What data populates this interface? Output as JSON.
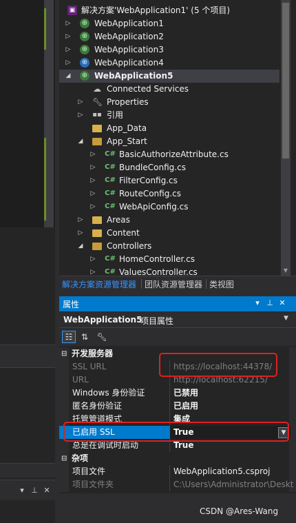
{
  "solution_explorer": {
    "solution": "解决方案'WebApplication1' (5 个项目)",
    "projects": [
      {
        "label": "WebApplication1"
      },
      {
        "label": "WebApplication2"
      },
      {
        "label": "WebApplication3"
      },
      {
        "label": "WebApplication4"
      }
    ],
    "active_project": "WebApplication5",
    "nodes": {
      "connected_services": "Connected Services",
      "properties": "Properties",
      "references": "引用",
      "app_data": "App_Data",
      "app_start": "App_Start",
      "app_start_files": [
        "BasicAuthorizeAttribute.cs",
        "BundleConfig.cs",
        "FilterConfig.cs",
        "RouteConfig.cs",
        "WebApiConfig.cs"
      ],
      "areas": "Areas",
      "content": "Content",
      "controllers": "Controllers",
      "controller_files": [
        "HomeController.cs",
        "ValuesController.cs"
      ]
    },
    "cs_badge": "C#"
  },
  "tabs": [
    "解决方案资源管理器",
    "团队资源管理器",
    "类视图"
  ],
  "properties_panel": {
    "title": "属性",
    "object_name": "WebApplication5",
    "object_type": "项目属性",
    "categories": [
      {
        "name": "开发服务器",
        "rows": [
          {
            "name": "SSL URL",
            "value": "https://localhost:44378/",
            "disabled": true
          },
          {
            "name": "URL",
            "value": "http://localhost:62215/",
            "disabled": true
          },
          {
            "name": "Windows 身份验证",
            "value": "已禁用"
          },
          {
            "name": "匿名身份验证",
            "value": "已启用"
          },
          {
            "name": "托管管道模式",
            "value": "集成"
          },
          {
            "name": "已启用 SSL",
            "value": "True",
            "selected": true
          },
          {
            "name": "总是在调试时启动",
            "value": "True"
          }
        ]
      },
      {
        "name": "杂项",
        "rows": [
          {
            "name": "项目文件",
            "value": "WebApplication5.csproj"
          },
          {
            "name": "项目文件夹",
            "value": "C:\\Users\\Administrator\\Deskt",
            "disabled": true
          }
        ]
      }
    ]
  },
  "watermark": "CSDN @Ares-Wang",
  "colors": {
    "accent": "#007acc",
    "highlight_box": "#e02020",
    "tab_active": "#3794ff"
  }
}
